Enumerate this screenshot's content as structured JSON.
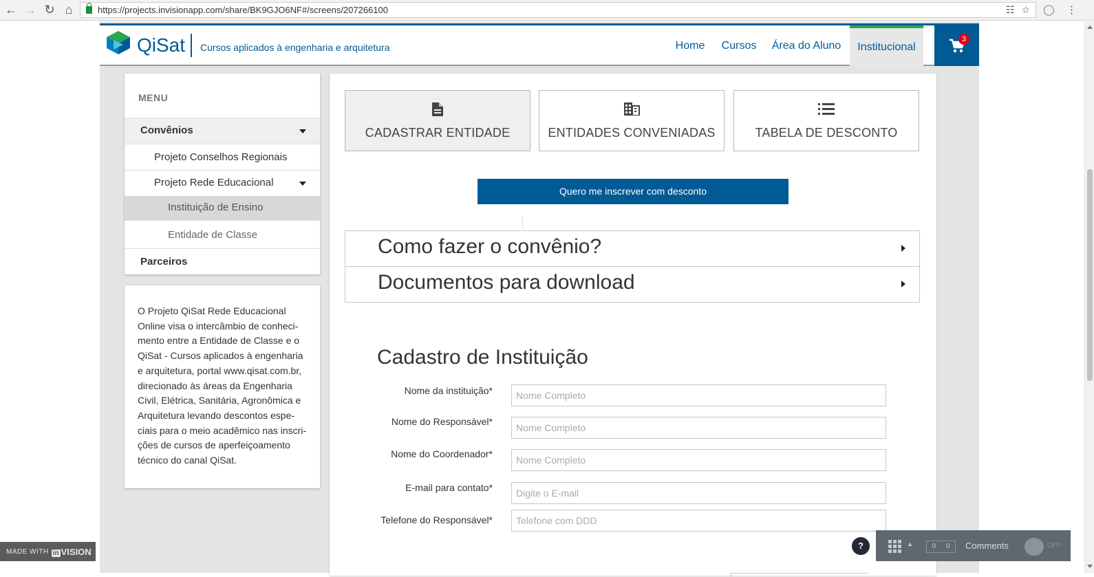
{
  "browser": {
    "url": "https://projects.invisionapp.com/share/BK9GJO6NF#/screens/207266100",
    "back_icon": "arrow-left-icon",
    "forward_icon": "arrow-right-icon",
    "reload_icon": "reload-icon",
    "home_icon": "home-icon",
    "lock_color": "#1e8e3e"
  },
  "header": {
    "brand": "QiSat",
    "tagline": "Cursos aplicados à engenharia e arquitetura",
    "nav": [
      "Home",
      "Cursos",
      "Área do Aluno",
      "Institucional"
    ],
    "active_nav": "Institucional",
    "cart_count": "3",
    "brand_color": "#005b94",
    "active_accent": "#2aa64f"
  },
  "sidebar": {
    "menu_title": "MENU",
    "items": [
      {
        "label": "Convênios"
      },
      {
        "label": "Projeto Conselhos Regionais"
      },
      {
        "label": "Projeto Rede Educacional"
      },
      {
        "label": "Instituição de Ensino"
      },
      {
        "label": "Entidade de Classe"
      },
      {
        "label": "Parceiros"
      }
    ],
    "selected_item": "Instituição de Ensino"
  },
  "info": {
    "lines": [
      "O Projeto QiSat Rede Educacional",
      "Online visa o intercâmbio de conheci-",
      "mento entre a Entidade de Classe e o",
      "QiSat - Cursos aplicados à engenharia",
      "e arquitetura, portal www.qisat.com.br,",
      "direcionado às áreas da Engenharia",
      "Civil, Elétrica, Sanitária, Agronômica e",
      "Arquitetura levando descontos espe-",
      "ciais para o meio acadêmico nas inscri-",
      "ções de cursos de aperfeiçoamento",
      "técnico do canal QiSat."
    ]
  },
  "tabs": [
    {
      "label": "CADASTRAR ENTIDADE",
      "icon": "document-icon",
      "active": true
    },
    {
      "label": "ENTIDADES CONVENIADAS",
      "icon": "building-icon",
      "active": false
    },
    {
      "label": "TABELA DE DESCONTO",
      "icon": "list-icon",
      "active": false
    }
  ],
  "cta_label": "Quero me inscrever com desconto",
  "accordion": [
    {
      "title": "Como fazer o convênio?"
    },
    {
      "title": "Documentos para download"
    }
  ],
  "form": {
    "title": "Cadastro de Instituição",
    "fields": [
      {
        "label": "Nome da instituição*",
        "placeholder": "Nome Completo"
      },
      {
        "label": "Nome do Responsável*",
        "placeholder": "Nome Completo"
      },
      {
        "label": "Nome do Coordenador*",
        "placeholder": "Nome Completo"
      },
      {
        "label": "E-mail para contato*",
        "placeholder": "Digite o E-mail"
      },
      {
        "label": "Telefone do Responsável*",
        "placeholder": "Telefone com DDD"
      }
    ]
  },
  "invision": {
    "made_with": "MADE WITH",
    "brand_in": "in",
    "brand_rest": "VISION",
    "help": "?",
    "counter_left": "0",
    "counter_right": "0",
    "comments": "Comments",
    "toggle": "OFF"
  }
}
